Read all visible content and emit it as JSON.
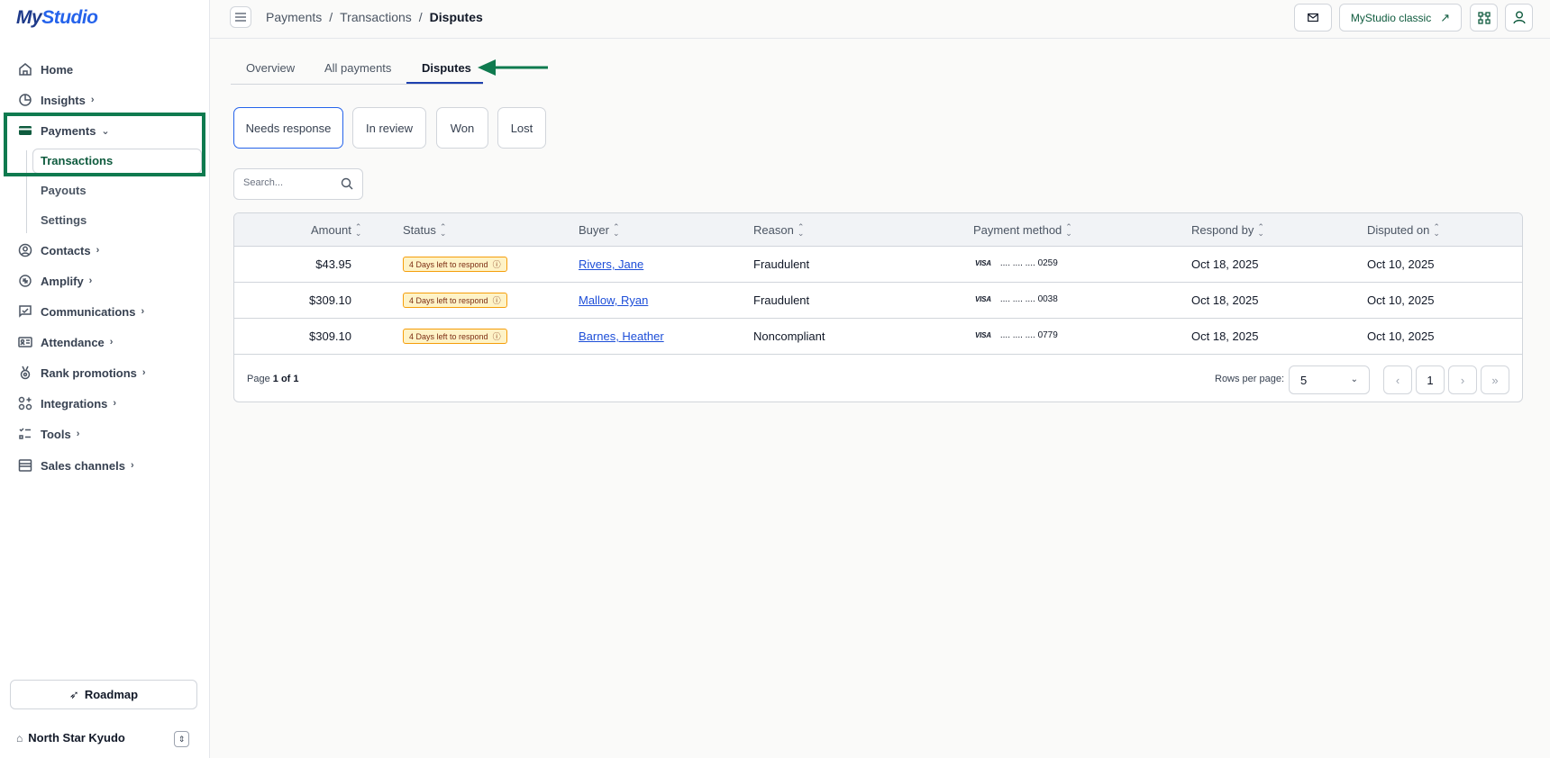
{
  "app": {
    "logo_my": "My",
    "logo_studio": "Studio"
  },
  "sidebar": {
    "items": [
      {
        "label": "Home",
        "icon": "home-icon"
      },
      {
        "label": "Insights",
        "icon": "pie-chart-icon"
      },
      {
        "label": "Payments",
        "icon": "credit-card-icon"
      },
      {
        "label": "Contacts",
        "icon": "user-circle-icon"
      },
      {
        "label": "Amplify",
        "icon": "sparkle-icon"
      },
      {
        "label": "Communications",
        "icon": "message-icon"
      },
      {
        "label": "Attendance",
        "icon": "id-card-icon"
      },
      {
        "label": "Rank promotions",
        "icon": "medal-icon"
      },
      {
        "label": "Integrations",
        "icon": "grid-plus-icon"
      },
      {
        "label": "Tools",
        "icon": "checklist-icon"
      },
      {
        "label": "Sales channels",
        "icon": "storefront-icon"
      }
    ],
    "payments_sub": [
      "Transactions",
      "Payouts",
      "Settings"
    ],
    "roadmap_label": "Roadmap",
    "org_name": "North Star Kyudo"
  },
  "topbar": {
    "breadcrumb": [
      "Payments",
      "Transactions",
      "Disputes"
    ],
    "classic_label": "MyStudio classic"
  },
  "tabs": [
    "Overview",
    "All payments",
    "Disputes"
  ],
  "filters": [
    "Needs response",
    "In review",
    "Won",
    "Lost"
  ],
  "search": {
    "placeholder": "Search..."
  },
  "table": {
    "headers": [
      "Amount",
      "Status",
      "Buyer",
      "Reason",
      "Payment method",
      "Respond by",
      "Disputed on"
    ],
    "rows": [
      {
        "amount": "$43.95",
        "status": "4 Days left to respond",
        "buyer": "Rivers, Jane",
        "reason": "Fraudulent",
        "card_brand": "VISA",
        "card_mask": ".... .... ....",
        "card_last4": "0259",
        "respond_by": "Oct 18, 2025",
        "disputed_on": "Oct 10, 2025"
      },
      {
        "amount": "$309.10",
        "status": "4 Days left to respond",
        "buyer": "Mallow, Ryan",
        "reason": "Fraudulent",
        "card_brand": "VISA",
        "card_mask": ".... .... ....",
        "card_last4": "0038",
        "respond_by": "Oct 18, 2025",
        "disputed_on": "Oct 10, 2025"
      },
      {
        "amount": "$309.10",
        "status": "4 Days left to respond",
        "buyer": "Barnes, Heather",
        "reason": "Noncompliant",
        "card_brand": "VISA",
        "card_mask": ".... .... ....",
        "card_last4": "0779",
        "respond_by": "Oct 18, 2025",
        "disputed_on": "Oct 10, 2025"
      }
    ],
    "page_prefix": "Page",
    "page_info": "1 of 1",
    "rows_per_page_label": "Rows per page:",
    "rows_per_page": "5",
    "current_page": "1"
  },
  "colors": {
    "accent": "#0f7a4f",
    "link": "#1d4ed8",
    "active_tab": "#1e40af",
    "badge_bg": "#fef3c7"
  }
}
